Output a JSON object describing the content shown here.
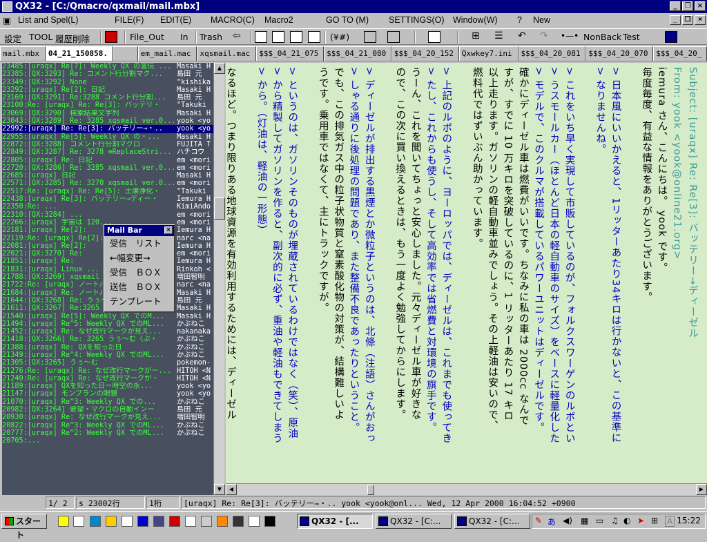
{
  "window": {
    "title": "QX32 - [C:/Qmacro/qxmail/mail.mbx]"
  },
  "menu": [
    "List and Spel(L)",
    "FILE(F)",
    "EDIT(E)",
    "MACRO(C)",
    "Macro2",
    "GO TO (M)",
    "SETTINGS(O)",
    "Window(W)",
    "?",
    "New"
  ],
  "toolbar": {
    "settings": "設定",
    "tool": "TOOL",
    "history": "履歴削除",
    "file_out": "File_Out",
    "in": "In",
    "trash": "Trash",
    "yen": "(¥#)",
    "nonback": "NonBack",
    "test": "Test"
  },
  "tabs": [
    "mail.mbx",
    "04_21_150858.",
    "em_mail.mac",
    "xqsmail.mac",
    "$$$_04_21_075",
    "$$$_04_21_080",
    "$$$_04_20_152",
    "Qxwkey7.ini",
    "$$$_04_20_081",
    "$$$_04_20_070",
    "$$$_04_20_"
  ],
  "mail_list": [
    {
      "subject": "23485:[uraqx] Re[7]: Weekly QX の宣伝 ...",
      "from": "Masaki H"
    },
    {
      "subject": "23385:[QX:3293] Re: コメント行分割マク...",
      "from": "島田 元"
    },
    {
      "subject": "23349:[QX:3292] None",
      "from": "\"kishika"
    },
    {
      "subject": "23292:[uraqx] Re[2]: 日記",
      "from": "Masaki H"
    },
    {
      "subject": "23169:[QX:3291] Re:3288 コメント行分割...",
      "from": "島田 元"
    },
    {
      "subject": "23100:Re: [uraqx] Re: Re[3]: バッテリ・",
      "from": "\"Takuki"
    },
    {
      "subject": "23069:[QX:3290] 検索結果文字列",
      "from": "Masaki H"
    },
    {
      "subject": "23043:[QX:3289] Re: 3285 xqsmail ver.0...",
      "from": "yook <yo"
    },
    {
      "subject": "22992:[uraqx] Re: Re[3]: バッテリー→・..",
      "from": "yook <yo",
      "selected": true
    },
    {
      "subject": "22955:[uraqx] Re[5]: Weekly QX の・...",
      "from": "Masaki H"
    },
    {
      "subject": "22872:[QX:3288] コメント行分割マクロ",
      "from": "FUJITA T"
    },
    {
      "subject": "22849:[QX:3287] Re: 3278 ⊕ReplaceStri...",
      "from": "ハチコウ"
    },
    {
      "subject": "22805:[uraqx] Re: 日記",
      "from": "em <mori"
    },
    {
      "subject": "22720:[QX:3286] Re: 3285 xqsmail ver.0...",
      "from": "em <mori"
    },
    {
      "subject": "22685:[uraqx] 日記",
      "from": "Masaki H"
    },
    {
      "subject": "22571:[QX:3285] Re: 3270 xqsmail ver.0...",
      "from": "em <mori"
    },
    {
      "subject": "22517:Re: [uraqx] Re: Re[5]: 土壌浄化・",
      "from": "\"Takuki"
    },
    {
      "subject": "22438:[uraqx] Re[3]: バッテリー→ディー・",
      "from": "Iemura H"
    },
    {
      "subject": "22350:Re: ...",
      "from": "KimiAndo"
    },
    {
      "subject": "22310:[QX:3284] ...",
      "from": "em <mori"
    },
    {
      "subject": "22266:[uraqx] 宇宙は 120...",
      "from": "em <mori"
    },
    {
      "subject": "22181:[uraqx] Re[2]:",
      "from": "Iemura H"
    },
    {
      "subject": "22119:Re: [uraqx] Re[2]:",
      "from": "narc <na"
    },
    {
      "subject": "22081:[uraqx] Re[2]:",
      "from": "Iemura H"
    },
    {
      "subject": "22021:[QX:3270] Re:",
      "from": "em <mori"
    },
    {
      "subject": "21851:[uraqx] Re:",
      "from": "Iemura H"
    },
    {
      "subject": "21831:[uraqx] Linux ...",
      "from": "Rinkoh <"
    },
    {
      "subject": "21788:[QX:3269] xqsmail ...",
      "from": "増田智明"
    },
    {
      "subject": "21722:Re: [uraqx] ノートパソコンのバッ...",
      "from": "narc <na"
    },
    {
      "subject": "21684:[uraqx] Re: ノートパソコンのバッ...",
      "from": "Masaki H"
    },
    {
      "subject": "21644:[QX:3268] Re: うぅ〜む",
      "from": "島田 元"
    },
    {
      "subject": "21611:[QX:3267] Re:3265 うぅ〜む",
      "from": "Masaki H"
    },
    {
      "subject": "21540:[uraqx] Re[5]: Weekly QX でのM...",
      "from": "Masaki H"
    },
    {
      "subject": "21494:[uraqx] Re^5: Weekly QX でのML...",
      "from": "かぶねこ"
    },
    {
      "subject": "21452:[uraqx] Re: なぜ改行マークが見え...",
      "from": "nakanaka"
    },
    {
      "subject": "21418:[QX:3266] Re: 3265 うぅ〜む〈ぶ・",
      "from": "かぶねこ"
    },
    {
      "subject": "21388:[uraqx] Re: QXを知った日",
      "from": "かぶねこ"
    },
    {
      "subject": "21349:[uraqx] Re^4: Weekly QX でのML...",
      "from": "かぶねこ"
    },
    {
      "subject": "21305:[QX:3265] うぅ〜む",
      "from": "pokemon-"
    },
    {
      "subject": "21276:Re: [uraqx] Re: なぜ改行マークがー...",
      "from": "HITOH <N"
    },
    {
      "subject": "21240:Re: [uraqx] Re: なぜ改行マークが・",
      "from": "HITOH <N"
    },
    {
      "subject": "21189:[uraqx] QXを知った日ー時空の永...",
      "from": "yook <yo"
    },
    {
      "subject": "21147:[uraqx] モンブランの眼鏡",
      "from": "yook <yo"
    },
    {
      "subject": "21070:[uraqx] Re^3: Weekly QX での...",
      "from": "かぶねこ"
    },
    {
      "subject": "20982:[QX:3264] 要望・マクロの自動インー",
      "from": "島田 元"
    },
    {
      "subject": "20930:[uraqx] Re: なぜ改行マークが見え...",
      "from": "増田智明"
    },
    {
      "subject": "20822:[uraqx] Re^3: Weekly QX でのML...",
      "from": "かぶねこ"
    },
    {
      "subject": "20777:[uraqx] Re^2: Weekly QX でのML...",
      "from": "かぶねこ"
    },
    {
      "subject": "20705:...",
      "from": ""
    }
  ],
  "mailbar": {
    "title": "Mail Bar",
    "items": [
      "受信　リスト",
      "←幅変更→",
      "受信　ＢＯＸ",
      "送信　ＢＯＸ",
      "テンプレート"
    ]
  },
  "message": {
    "columns": [
      {
        "text": "Subject: [uraqx] Re: Re[3]: バッテリー→ディーゼル",
        "color": "teal"
      },
      {
        "text": "From: yook <yook@online21.org>",
        "color": "teal"
      },
      {
        "text": "iemura さん、こんにちは。 yook です。",
        "color": "black"
      },
      {
        "text": "毎度毎度、有益な情報をありがとうございます。",
        "color": "black"
      },
      {
        "text": "",
        "color": "black"
      },
      {
        "text": "> 日本風にいいかえると、1リッターあたり34キロは行かないと、この基準に",
        "color": "blue"
      },
      {
        "text": "> なりませんね。",
        "color": "blue"
      },
      {
        "text": "",
        "color": "black"
      },
      {
        "text": "> これをいち早く実現して市販しているのが、フォルクスワーゲンのルポとい",
        "color": "blue"
      },
      {
        "text": "> うスモールカー（ほとんど日本の軽自動車のサイズ）をベースに軽量化した",
        "color": "blue"
      },
      {
        "text": "> モデルで、このクルマが搭載しているパワーユニットはディーゼルです。",
        "color": "blue"
      },
      {
        "text": "確かにディーゼル車は燃費がいいです。ちなみに私の車は 2000cc なんで",
        "color": "black"
      },
      {
        "text": "すが、すでに 10 万キロを突破しているのに、1 リッターあたり 17 キロ",
        "color": "black"
      },
      {
        "text": "以上走ります。ガソリンの軽自動車並みでしょう。その上軽油は安いので、",
        "color": "black"
      },
      {
        "text": "燃料代ではずいぶん助かっています。",
        "color": "black"
      },
      {
        "text": "",
        "color": "black"
      },
      {
        "text": "> 上記のルポのように、ヨーロッパでは、ディーゼルは、これまでも使ってき",
        "color": "blue"
      },
      {
        "text": "> たし、これからも使うし、そして高効率では省燃費と対環境の旗手です。",
        "color": "blue"
      },
      {
        "text": "うーん、これを聞いてちょっと安心しました。元々ディーゼル車が好きな",
        "color": "black"
      },
      {
        "text": "ので、この次に買い換えるときは、もう一度よく勉強してからにします。",
        "color": "black"
      },
      {
        "text": "",
        "color": "black"
      },
      {
        "text": "> ディーゼルが排出する黒煙とか微粒子というのは、北條（注語）さんがおっ",
        "color": "blue"
      },
      {
        "text": "> しゃる通りに後処理の問題であり、また整備不良であったりということ。",
        "color": "blue"
      },
      {
        "text": "でも、この排気ガス中の粒子状物質と窒素酸化物の対策が、結構難しいよ",
        "color": "black"
      },
      {
        "text": "うです。乗用車ではなくて、主にトラックですが。",
        "color": "black"
      },
      {
        "text": "",
        "color": "black"
      },
      {
        "text": "> というのは、ガソリンそのものが埋蔵されているわけではなく（笑）、原油",
        "color": "blue"
      },
      {
        "text": "> から精製してガソリンを作ると、副次的に必ず、重油や軽油もできてしまう",
        "color": "blue"
      },
      {
        "text": "> から。（灯油は、軽油の一形態）",
        "color": "blue"
      },
      {
        "text": "",
        "color": "black"
      },
      {
        "text": "なるほど。つまり限りある地球資源を有効利用するためには、ディーゼル",
        "color": "black"
      }
    ]
  },
  "statusbar": {
    "page": "1/ 2",
    "line": "s 23002行",
    "col": "1桁",
    "info": "[uraqx] Re: Re[3]: バッテリー→・.. yook <yook@onl... Wed, 12 Apr 2000 16:04:52 +0900"
  },
  "taskbar": {
    "start": "スタート",
    "tasks": [
      "QX32 - [...",
      "QX32 - [C:...",
      "QX32 - [C:..."
    ],
    "clock": "15:22",
    "ime": "A"
  }
}
